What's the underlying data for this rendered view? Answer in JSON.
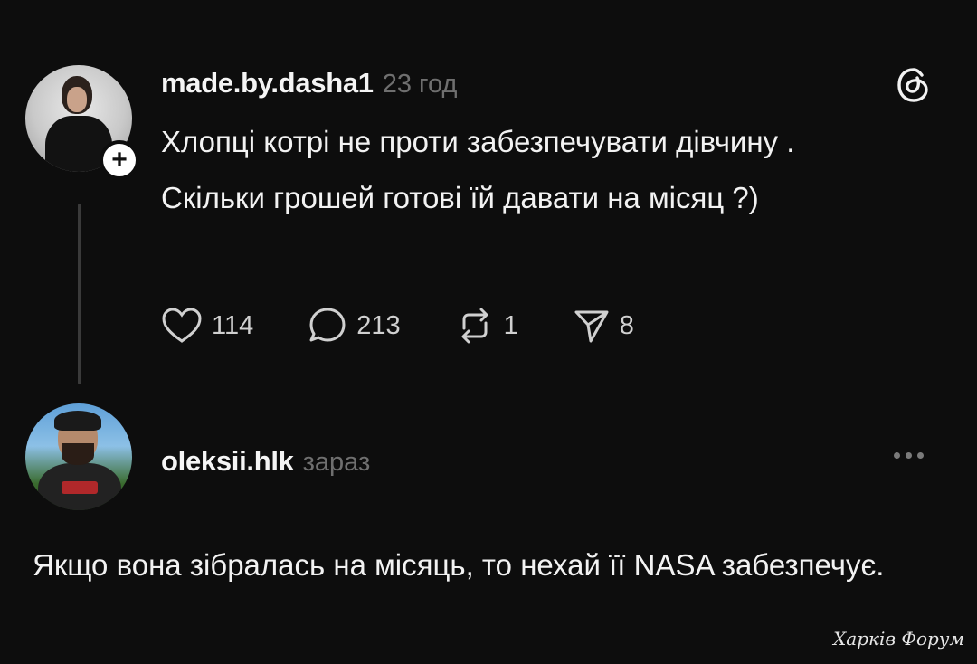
{
  "post": {
    "username": "made.by.dasha1",
    "time": "23 год",
    "text_line1": "Хлопці котрі не проти забезпечувати дівчину .",
    "text_line2": "Скільки грошей готові їй давати на місяц ?)",
    "follow_icon": "plus-icon",
    "app_icon": "threads-logo",
    "actions": {
      "likes": "114",
      "comments": "213",
      "reposts": "1",
      "shares": "8"
    }
  },
  "reply": {
    "username": "oleksii.hlk",
    "time": "зараз",
    "more_icon": "more-horizontal-icon",
    "text": "Якщо вона зібралась на місяць, то нехай її NASA забезпечує."
  },
  "watermark": "Харків Форум",
  "colors": {
    "background": "#0d0d0d",
    "text": "#f2f2f2",
    "muted": "#6f6f6f"
  }
}
